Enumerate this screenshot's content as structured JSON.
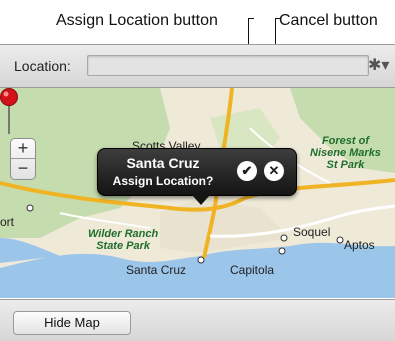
{
  "callouts": {
    "assign": "Assign Location button",
    "cancel": "Cancel button"
  },
  "toolbar": {
    "location_label": "Location:",
    "location_value": "",
    "gear_icon": "gear-icon"
  },
  "map": {
    "zoom_in": "+",
    "zoom_out": "−",
    "labels": {
      "scotts_valley": "Scotts Valley",
      "forest_1": "Forest of",
      "forest_2": "Nisene Marks",
      "forest_3": "St Park",
      "wilder_1": "Wilder Ranch",
      "wilder_2": "State Park",
      "santa_cruz": "Santa Cruz",
      "capitola": "Capitola",
      "soquel": "Soquel",
      "aptos": "Aptos",
      "port": "ort"
    },
    "colors": {
      "land": "#efe9d8",
      "water": "#9cc5ea",
      "park": "#c5dcae",
      "highway": "#f0b323"
    }
  },
  "popup": {
    "title": "Santa Cruz",
    "subtitle": "Assign Location?",
    "assign_glyph": "✔",
    "cancel_glyph": "✕"
  },
  "footer": {
    "hide_map": "Hide Map"
  }
}
